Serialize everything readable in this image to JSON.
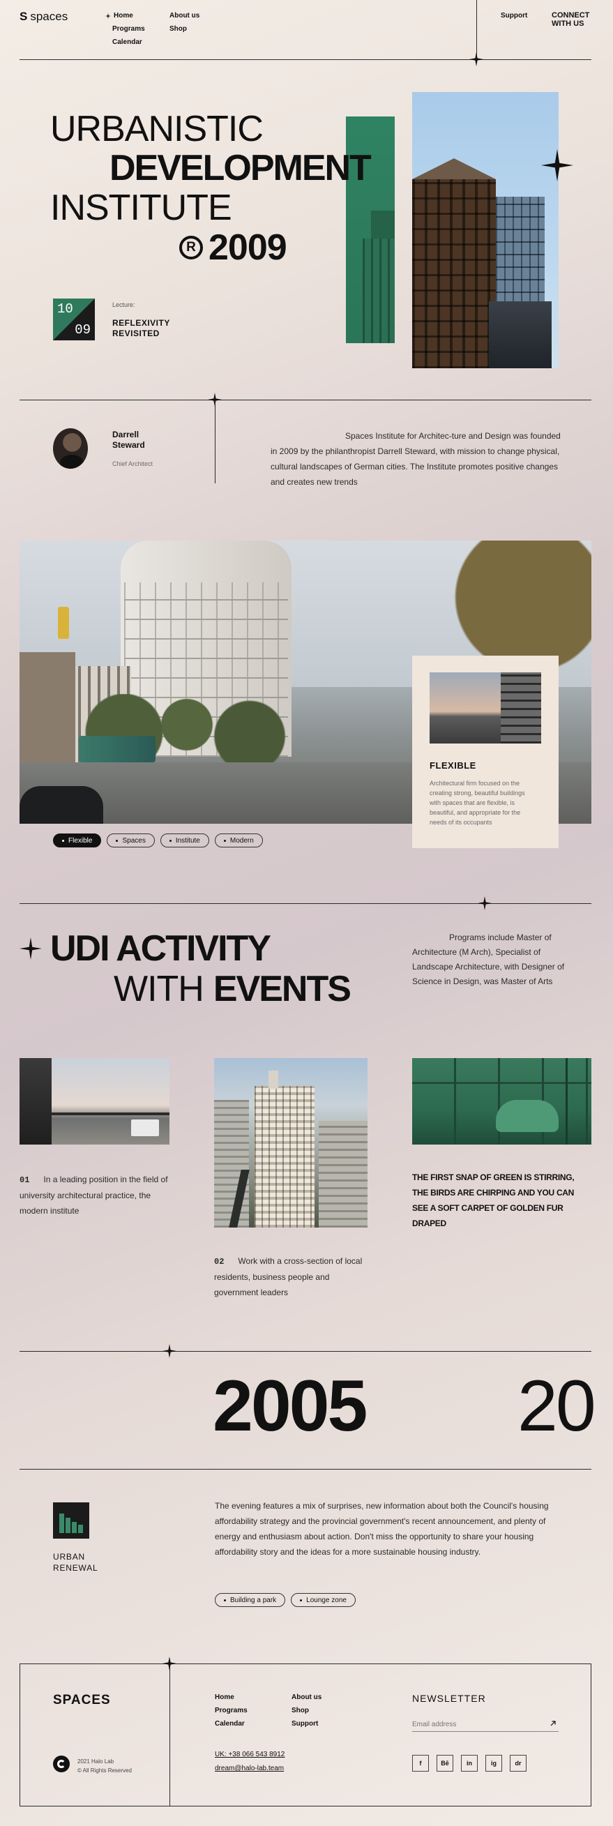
{
  "header": {
    "logo": "spaces",
    "nav_col1": [
      "Home",
      "Programs",
      "Calendar"
    ],
    "nav_col2": [
      "About us",
      "Shop"
    ],
    "support": "Support",
    "connect": "CONNECT WITH US"
  },
  "hero": {
    "line1": "URBANISTIC",
    "line2": "DEVELOPMENT",
    "line3": "INSTITUTE",
    "year": "2009",
    "date_top": "10",
    "date_bottom": "09",
    "lecture_label": "Lecture:",
    "lecture_title": "REFLEXIVITY REVISITED"
  },
  "about": {
    "name": "Darrell Steward",
    "role": "Chief Architect",
    "text": "Spaces Institute for Architec-ture and Design was founded in 2009 by the philanthropist Darrell Steward, with mission to change physical, cultural landscapes of German cities. The Institute promotes positive changes and creates new trends"
  },
  "gallery": {
    "tags": [
      "Flexible",
      "Spaces",
      "Institute",
      "Modern"
    ],
    "card_title": "FLEXIBLE",
    "card_text": "Architectural firm focused on the creating strong, beautiful buildings with spaces that are flexible, is beautiful, and appropriate for the needs of its occupants"
  },
  "activity": {
    "title_a": "UDI ACTIVITY",
    "title_b": "WITH",
    "title_c": "EVENTS",
    "text": "Programs include Master of Architecture (M Arch), Specialist of Landscape Architecture, with Designer of Science in Design, was Master of Arts"
  },
  "events": [
    {
      "num": "01",
      "text": "In a leading position in the field of university architectural practice, the modern institute"
    },
    {
      "num": "02",
      "text": "Work with a cross-section of local residents, business people and government leaders"
    },
    {
      "text": "THE FIRST SNAP OF GREEN IS STIRRING, THE BIRDS ARE CHIRPING AND YOU CAN SEE A SOFT CARPET OF GOLDEN FUR DRAPED"
    }
  ],
  "timeline": {
    "year_main": "2005",
    "year_next": "20"
  },
  "renewal": {
    "label": "URBAN RENEWAL",
    "text": "The evening features a mix of surprises, new information about both the Council's housing affordability strategy and the provincial government's recent announcement, and plenty of energy and enthusiasm about action. Don't miss the opportunity to share your housing affordability story and the ideas for a more sustainable housing industry.",
    "tags": [
      "Building a park",
      "Lounge zone"
    ]
  },
  "footer": {
    "brand": "SPACES",
    "copyright_line1": "2021 Halo Lab",
    "copyright_line2": "© All Rights Reserved",
    "nav_col1": [
      "Home",
      "Programs",
      "Calendar"
    ],
    "nav_col2": [
      "About us",
      "Shop",
      "Support"
    ],
    "phone": "UK: +38 066 543 8912",
    "email": "dream@halo-lab.team",
    "newsletter": "NEWSLETTER",
    "email_placeholder": "Email address",
    "socials": [
      "f",
      "Bē",
      "in",
      "ig",
      "dr"
    ]
  },
  "colors": {
    "accent_green": "#2f7a5c",
    "ink": "#111111"
  }
}
